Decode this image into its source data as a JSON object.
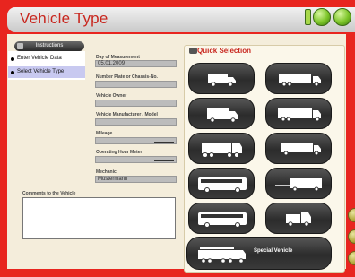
{
  "window": {
    "title": "Vehicle Type",
    "controls": [
      "window-bar-icon",
      "minimize-dot-icon",
      "close-dot-icon"
    ]
  },
  "sidebar": {
    "instructions_label": "Instructions",
    "steps": [
      {
        "label": "Enter Vehicle Data",
        "active": false
      },
      {
        "label": "Select Vehicle Type",
        "active": true
      }
    ]
  },
  "form": {
    "fields": [
      {
        "label": "Day of Measurement",
        "value": "05.01.2009"
      },
      {
        "label": "Number Plate or Chassis-No.",
        "value": ""
      },
      {
        "label": "Vehicle Owner",
        "value": ""
      },
      {
        "label": "Vehicle Manufacturer / Model",
        "value": ""
      },
      {
        "label": "Mileage",
        "value": ""
      },
      {
        "label": "Operating Hour Meter",
        "value": ""
      },
      {
        "label": "Mechanic",
        "value": "Mustermann"
      }
    ],
    "comments_label": "Comments to the Vehicle",
    "comments_value": ""
  },
  "quick_selection": {
    "title": "Quick Selection",
    "vehicles": [
      {
        "icon": "van-icon"
      },
      {
        "icon": "semi-trailer-icon"
      },
      {
        "icon": "box-truck-icon"
      },
      {
        "icon": "long-trailer-truck-icon"
      },
      {
        "icon": "heavy-truck-icon"
      },
      {
        "icon": "flatbed-truck-icon"
      },
      {
        "icon": "coach-bus-icon"
      },
      {
        "icon": "drawbar-trailer-icon"
      },
      {
        "icon": "city-bus-icon"
      },
      {
        "icon": "pickup-truck-icon"
      }
    ],
    "special_vehicle_label": "Special Vehicle",
    "special_icon": "crane-truck-icon"
  },
  "colors": {
    "frame": "#e8251f",
    "title_text": "#c8261e",
    "content_bg": "#f4eddb",
    "button_dark": "#2c2c2c",
    "active_step": "#c8c9f0",
    "window_dot": "#7cc528"
  }
}
